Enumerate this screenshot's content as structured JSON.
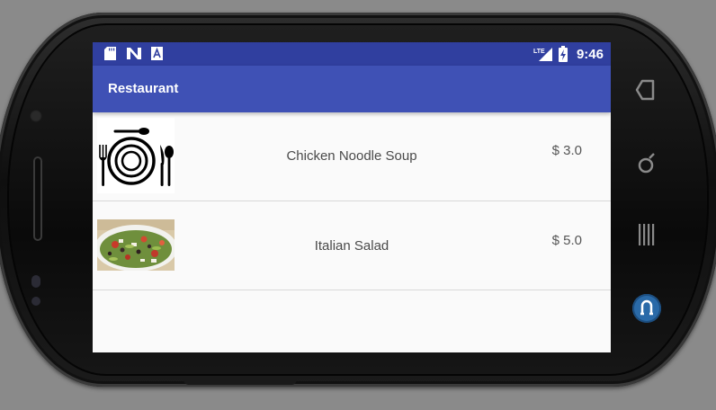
{
  "status_bar": {
    "time": "9:46",
    "network": "LTE",
    "left_icons": [
      "sd-card-icon",
      "n-notification-icon",
      "a-notification-icon"
    ],
    "right_icons": [
      "lte-signal-icon",
      "battery-charging-icon"
    ]
  },
  "app_bar": {
    "title": "Restaurant",
    "background": "#3f51b5",
    "status_background": "#303f9f"
  },
  "menu": {
    "items": [
      {
        "name": "Chicken Noodle Soup",
        "price": "$ 3.0",
        "image": "plate-cutlery-icon"
      },
      {
        "name": "Italian Salad",
        "price": "$ 5.0",
        "image": "salad-photo"
      }
    ]
  },
  "hardware_buttons": [
    "back-icon",
    "home-icon",
    "recent-apps-icon",
    "assistant-icon"
  ],
  "colors": {
    "list_background": "#fafafa",
    "divider": "#d8d8d8"
  }
}
